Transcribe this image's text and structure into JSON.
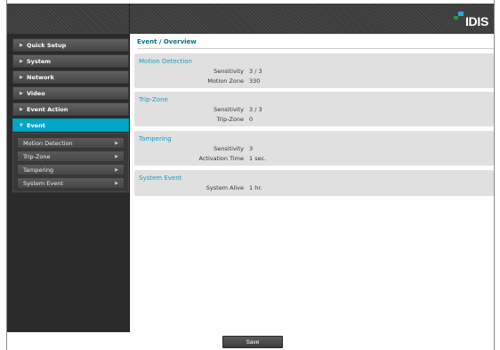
{
  "brand": {
    "logo_text": "IDIS",
    "logo_colors": [
      "#29a8e0",
      "#2f8f3e"
    ]
  },
  "accent_color": "#00a7c6",
  "sidebar": {
    "items": [
      {
        "label": "Quick Setup",
        "expanded": false
      },
      {
        "label": "System",
        "expanded": false
      },
      {
        "label": "Network",
        "expanded": false
      },
      {
        "label": "Video",
        "expanded": false
      },
      {
        "label": "Event Action",
        "expanded": false
      },
      {
        "label": "Event",
        "expanded": true,
        "active": true
      }
    ],
    "submenu": [
      {
        "label": "Motion Detection"
      },
      {
        "label": "Trip-Zone"
      },
      {
        "label": "Tampering"
      },
      {
        "label": "System Event"
      }
    ]
  },
  "main": {
    "title": "Event / Overview",
    "groups": [
      {
        "title": "Motion Detection",
        "rows": [
          {
            "label": "Sensitivity",
            "value": "3 / 3"
          },
          {
            "label": "Motion Zone",
            "value": "330"
          }
        ]
      },
      {
        "title": "Trip-Zone",
        "rows": [
          {
            "label": "Sensitivity",
            "value": "3 / 3"
          },
          {
            "label": "Trip-Zone",
            "value": "0"
          }
        ]
      },
      {
        "title": "Tampering",
        "rows": [
          {
            "label": "Sensitivity",
            "value": "3"
          },
          {
            "label": "Activation Time",
            "value": "1 sec."
          }
        ]
      },
      {
        "title": "System Event",
        "rows": [
          {
            "label": "System Alive",
            "value": "1 hr."
          }
        ]
      }
    ]
  },
  "footer": {
    "save_label": "Save"
  }
}
